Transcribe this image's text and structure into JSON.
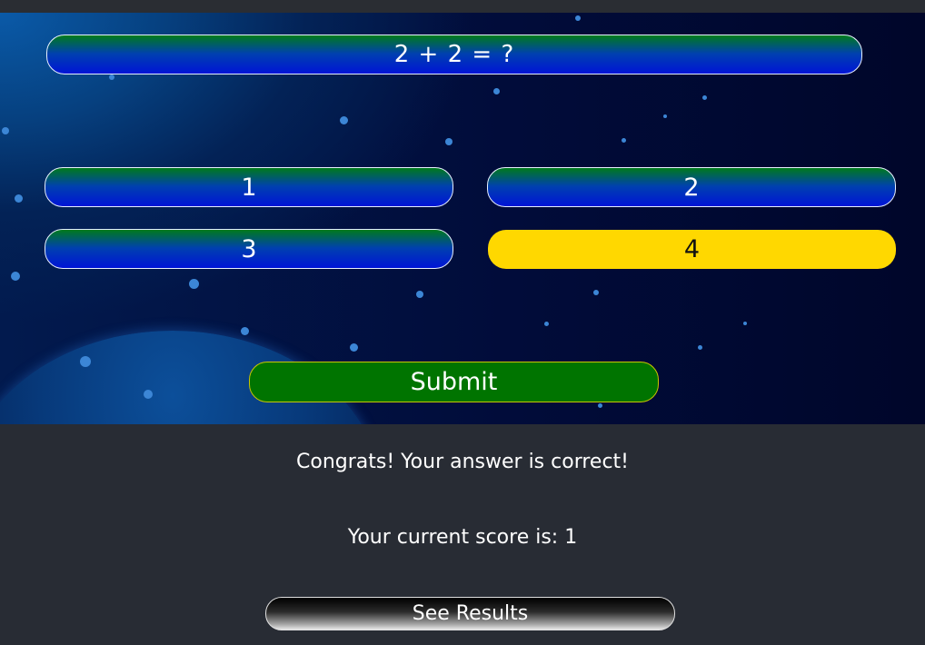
{
  "quiz": {
    "question": "2 + 2 = ?",
    "options": [
      "1",
      "2",
      "3",
      "4"
    ],
    "selected_option": "4",
    "submit_label": "Submit"
  },
  "feedback": {
    "message": "Congrats! Your answer is correct!",
    "score_text": "Your current score is: 1",
    "results_label": "See Results"
  },
  "colors": {
    "option_gradient_top": "#007a1c",
    "option_gradient_bottom": "#0014d6",
    "selected_option": "#ffd800",
    "submit_button": "#007400",
    "page_background": "#282c34"
  }
}
